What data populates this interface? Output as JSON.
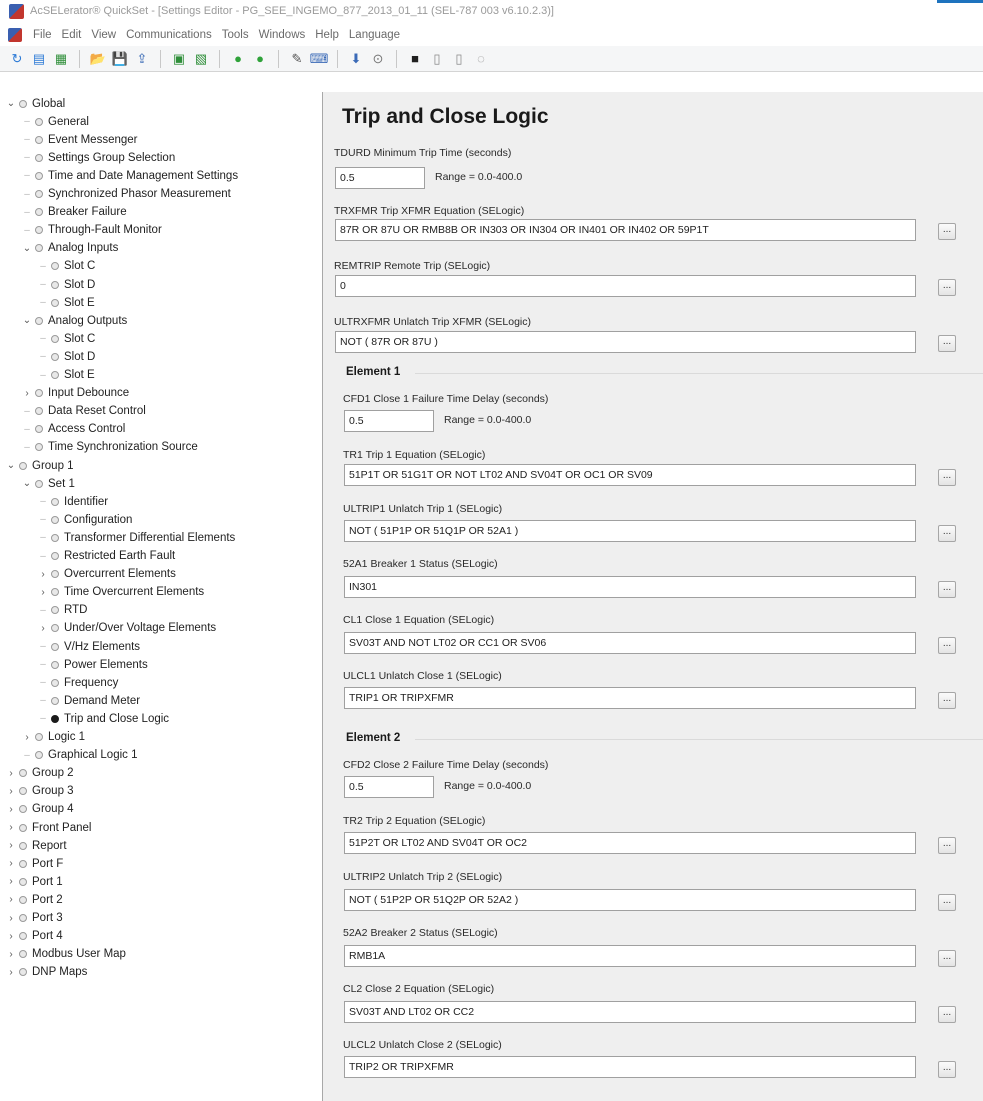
{
  "window": {
    "title": "AcSELerator® QuickSet - [Settings Editor - PG_SEE_INGEMO_877_2013_01_11 (SEL-787 003 v6.10.2.3)]"
  },
  "menu": [
    "File",
    "Edit",
    "View",
    "Communications",
    "Tools",
    "Windows",
    "Help",
    "Language"
  ],
  "toolbar": {
    "icons": [
      "refresh-icon",
      "read-icon",
      "open-icon",
      "folder-icon",
      "save-icon",
      "send-icon",
      "report-icon",
      "export-icon",
      "go-green-icon",
      "go-green2-icon",
      "wrench-icon",
      "terminal-icon",
      "event-icon",
      "meter-icon",
      "hmi-icon",
      "help-icon",
      "doc-icon",
      "settings-icon"
    ],
    "glyphs": [
      "↻",
      "▤",
      "▦",
      "📂",
      "💾",
      "⇪",
      "▣",
      "▧",
      "●",
      "●",
      "✎",
      "⌨",
      "⬇",
      "⊙",
      "■",
      "▯",
      "▯",
      "◌"
    ],
    "colors": [
      "#2c7ad6",
      "#2c7ad6",
      "#2f8f3a",
      "#e3a21a",
      "#2b5fb0",
      "#2b5fb0",
      "#2f8f3a",
      "#2f8f3a",
      "#2fa23a",
      "#2fa23a",
      "#555555",
      "#3a6ab7",
      "#3a6ab7",
      "#777777",
      "#202020",
      "#8a8a8a",
      "#8a8a8a",
      "#8a8a8a"
    ]
  },
  "tree": [
    {
      "label": "Global",
      "depth": 0,
      "chevron": "expanded"
    },
    {
      "label": "General",
      "depth": 1
    },
    {
      "label": "Event Messenger",
      "depth": 1
    },
    {
      "label": "Settings Group Selection",
      "depth": 1
    },
    {
      "label": "Time and Date Management Settings",
      "depth": 1
    },
    {
      "label": "Synchronized Phasor Measurement",
      "depth": 1
    },
    {
      "label": "Breaker Failure",
      "depth": 1
    },
    {
      "label": "Through-Fault Monitor",
      "depth": 1
    },
    {
      "label": "Analog Inputs",
      "depth": 1,
      "chevron": "expanded"
    },
    {
      "label": "Slot C",
      "depth": 2
    },
    {
      "label": "Slot D",
      "depth": 2
    },
    {
      "label": "Slot E",
      "depth": 2
    },
    {
      "label": "Analog Outputs",
      "depth": 1,
      "chevron": "expanded"
    },
    {
      "label": "Slot C",
      "depth": 2
    },
    {
      "label": "Slot D",
      "depth": 2
    },
    {
      "label": "Slot E",
      "depth": 2
    },
    {
      "label": "Input Debounce",
      "depth": 1,
      "chevron": "collapsed"
    },
    {
      "label": "Data Reset Control",
      "depth": 1
    },
    {
      "label": "Access Control",
      "depth": 1
    },
    {
      "label": "Time Synchronization Source",
      "depth": 1
    },
    {
      "label": "Group 1",
      "depth": 0,
      "chevron": "expanded"
    },
    {
      "label": "Set 1",
      "depth": 1,
      "chevron": "expanded"
    },
    {
      "label": "Identifier",
      "depth": 2
    },
    {
      "label": "Configuration",
      "depth": 2
    },
    {
      "label": "Transformer Differential Elements",
      "depth": 2
    },
    {
      "label": "Restricted Earth Fault",
      "depth": 2
    },
    {
      "label": "Overcurrent Elements",
      "depth": 2,
      "chevron": "collapsed"
    },
    {
      "label": "Time Overcurrent Elements",
      "depth": 2,
      "chevron": "collapsed"
    },
    {
      "label": "RTD",
      "depth": 2
    },
    {
      "label": "Under/Over Voltage Elements",
      "depth": 2,
      "chevron": "collapsed"
    },
    {
      "label": "V/Hz Elements",
      "depth": 2
    },
    {
      "label": "Power Elements",
      "depth": 2
    },
    {
      "label": "Frequency",
      "depth": 2
    },
    {
      "label": "Demand Meter",
      "depth": 2
    },
    {
      "label": "Trip and Close Logic",
      "depth": 2,
      "selected": true
    },
    {
      "label": "Logic 1",
      "depth": 1,
      "chevron": "collapsed"
    },
    {
      "label": "Graphical Logic 1",
      "depth": 1
    },
    {
      "label": "Group 2",
      "depth": 0,
      "chevron": "collapsed"
    },
    {
      "label": "Group 3",
      "depth": 0,
      "chevron": "collapsed"
    },
    {
      "label": "Group 4",
      "depth": 0,
      "chevron": "collapsed"
    },
    {
      "label": "Front Panel",
      "depth": 0,
      "chevron": "collapsed"
    },
    {
      "label": "Report",
      "depth": 0,
      "chevron": "collapsed"
    },
    {
      "label": "Port F",
      "depth": 0,
      "chevron": "collapsed"
    },
    {
      "label": "Port 1",
      "depth": 0,
      "chevron": "collapsed"
    },
    {
      "label": "Port 2",
      "depth": 0,
      "chevron": "collapsed"
    },
    {
      "label": "Port 3",
      "depth": 0,
      "chevron": "collapsed"
    },
    {
      "label": "Port 4",
      "depth": 0,
      "chevron": "collapsed"
    },
    {
      "label": "Modbus User Map",
      "depth": 0,
      "chevron": "collapsed"
    },
    {
      "label": "DNP Maps",
      "depth": 0,
      "chevron": "collapsed"
    }
  ],
  "main": {
    "title": "Trip and Close Logic",
    "tdurd": {
      "label": "TDURD  Minimum Trip Time (seconds)",
      "value": "0.5",
      "range": "Range = 0.0-400.0"
    },
    "trxfmr": {
      "label": "TRXFMR  Trip XFMR Equation (SELogic)",
      "value": "87R OR 87U OR RMB8B OR IN303 OR IN304 OR IN401 OR IN402 OR 59P1T"
    },
    "remtrip": {
      "label": "REMTRIP  Remote Trip (SELogic)",
      "value": "0"
    },
    "ultrxfmr": {
      "label": "ULTRXFMR  Unlatch Trip XFMR (SELogic)",
      "value": "NOT ( 87R OR 87U )"
    },
    "element1": {
      "title": "Element 1",
      "cfd1": {
        "label": "CFD1  Close 1 Failure Time Delay (seconds)",
        "value": "0.5",
        "range": "Range = 0.0-400.0"
      },
      "tr1": {
        "label": "TR1  Trip 1 Equation (SELogic)",
        "value": "51P1T OR 51G1T OR NOT LT02 AND SV04T OR OC1 OR SV09"
      },
      "ultrip1": {
        "label": "ULTRIP1  Unlatch Trip 1 (SELogic)",
        "value": "NOT ( 51P1P OR 51Q1P OR 52A1 )"
      },
      "s52a1": {
        "label": "52A1  Breaker 1 Status (SELogic)",
        "value": "IN301"
      },
      "cl1": {
        "label": "CL1  Close 1 Equation (SELogic)",
        "value": "SV03T AND NOT LT02 OR CC1 OR SV06"
      },
      "ulcl1": {
        "label": "ULCL1  Unlatch Close 1 (SELogic)",
        "value": "TRIP1 OR TRIPXFMR"
      }
    },
    "element2": {
      "title": "Element 2",
      "cfd2": {
        "label": "CFD2  Close 2 Failure Time Delay (seconds)",
        "value": "0.5",
        "range": "Range = 0.0-400.0"
      },
      "tr2": {
        "label": "TR2  Trip 2 Equation (SELogic)",
        "value": "51P2T OR LT02 AND SV04T OR OC2"
      },
      "ultrip2": {
        "label": "ULTRIP2  Unlatch Trip 2 (SELogic)",
        "value": "NOT ( 51P2P OR 51Q2P OR 52A2 )"
      },
      "s52a2": {
        "label": "52A2  Breaker 2 Status (SELogic)",
        "value": "RMB1A"
      },
      "cl2": {
        "label": "CL2  Close 2 Equation (SELogic)",
        "value": "SV03T AND LT02 OR CC2"
      },
      "ulcl2": {
        "label": "ULCL2  Unlatch Close 2 (SELogic)",
        "value": "TRIP2 OR TRIPXFMR"
      }
    },
    "ellipsis_label": "..."
  }
}
